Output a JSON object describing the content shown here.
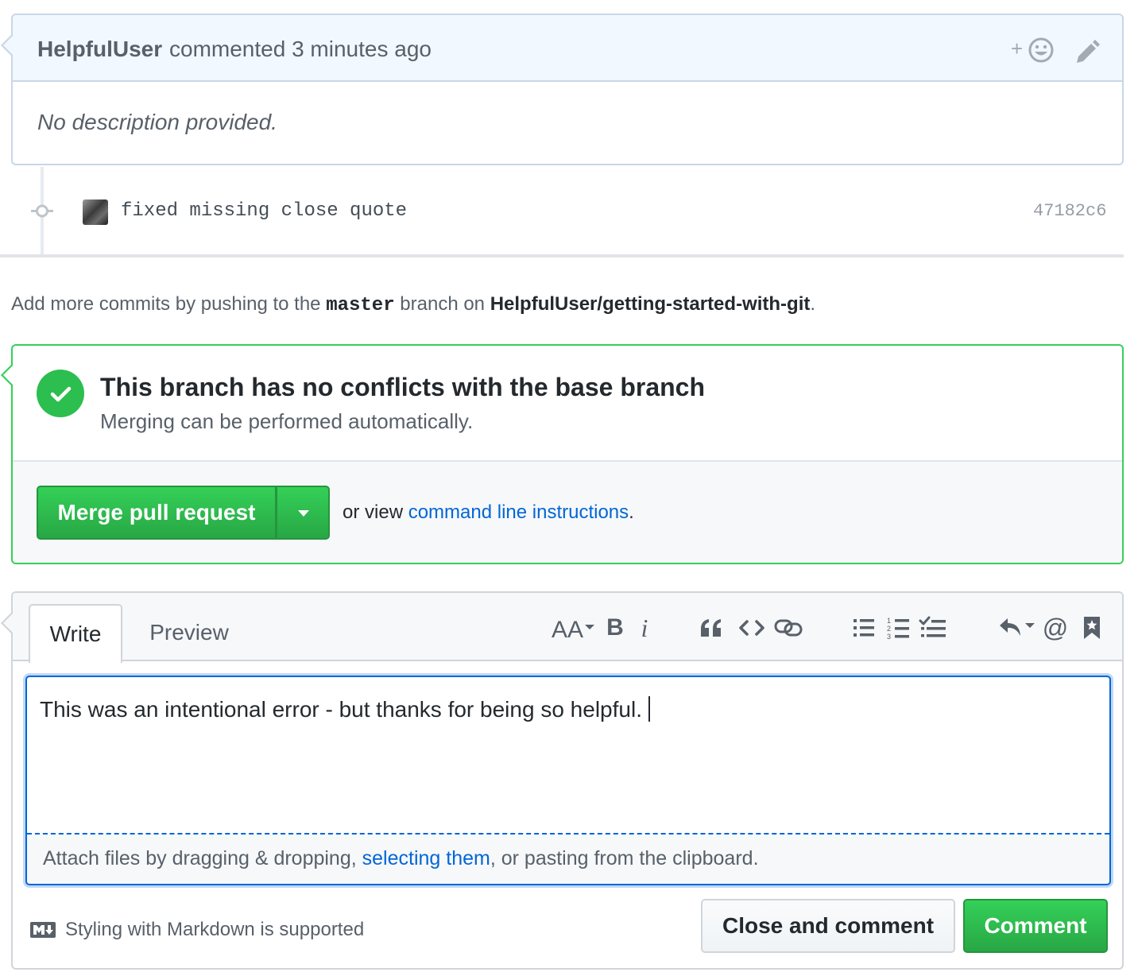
{
  "comment": {
    "author": "HelpfulUser",
    "meta": "commented 3 minutes ago",
    "reaction_label": "+",
    "body": "No description provided."
  },
  "commit": {
    "message": "fixed missing close quote",
    "sha": "47182c6"
  },
  "push_hint": {
    "prefix": "Add more commits by pushing to the ",
    "branch": "master",
    "middle": " branch on ",
    "repo": "HelpfulUser/getting-started-with-git",
    "suffix": "."
  },
  "merge": {
    "title": "This branch has no conflicts with the base branch",
    "subtitle": "Merging can be performed automatically.",
    "button_label": "Merge pull request",
    "alt_prefix": "or view ",
    "alt_link": "command line instructions",
    "alt_suffix": "."
  },
  "compose": {
    "tabs": {
      "write": "Write",
      "preview": "Preview"
    },
    "toolbar": {
      "bold": "B",
      "italic": "i",
      "mention": "@",
      "icons": [
        "text-size-icon",
        "bold-icon",
        "italic-icon",
        "quote-icon",
        "code-icon",
        "link-icon",
        "unordered-list-icon",
        "ordered-list-icon",
        "task-list-icon",
        "reply-icon",
        "mention-icon",
        "bookmark-icon"
      ]
    },
    "text": "This was an intentional error - but thanks for being so helpful.",
    "attach_prefix": "Attach files by dragging & dropping, ",
    "attach_link": "selecting them",
    "attach_suffix": ", or pasting from the clipboard.",
    "markdown_hint": "Styling with Markdown is supported",
    "close_button": "Close and comment",
    "comment_button": "Comment"
  },
  "colors": {
    "accent_blue": "#0366d6",
    "success_green": "#2cbe4e",
    "header_blue_bg": "#f1f8ff"
  }
}
